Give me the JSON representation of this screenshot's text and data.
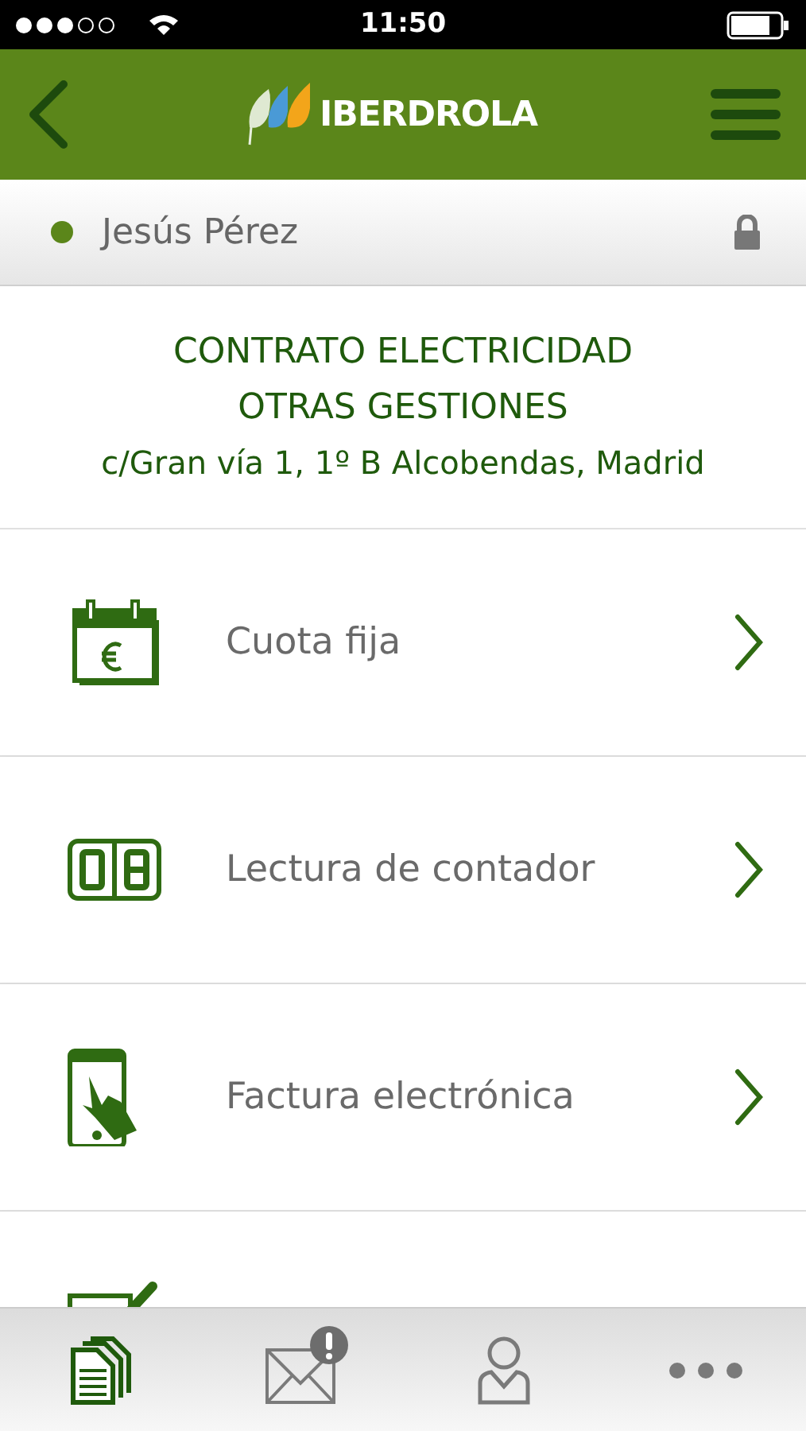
{
  "status_bar": {
    "time": "11:50",
    "signal_dots": [
      {
        "on": true
      },
      {
        "on": true
      },
      {
        "on": true
      },
      {
        "on": false
      },
      {
        "on": false
      }
    ]
  },
  "header": {
    "logo_text": "IBERDROLA"
  },
  "user": {
    "name": "Jesús Pérez",
    "online": true
  },
  "contract": {
    "lines": [
      "CONTRATO ELECTRICIDAD",
      "OTRAS GESTIONES",
      "c/Gran vía 1, 1º B Alcobendas, Madrid"
    ]
  },
  "menu_items": [
    {
      "kind": "calendar",
      "label": "Cuota fija"
    },
    {
      "kind": "counter",
      "label": "Lectura de contador"
    },
    {
      "kind": "phone",
      "label": "Factura electrónica"
    },
    {
      "kind": "edit"
    }
  ],
  "tab_bar": [
    {
      "kind": "documents",
      "selected": true,
      "badge": false
    },
    {
      "kind": "mail",
      "selected": false,
      "badge": true
    },
    {
      "kind": "user",
      "selected": false,
      "badge": false
    },
    {
      "kind": "more",
      "selected": false,
      "badge": false
    }
  ]
}
